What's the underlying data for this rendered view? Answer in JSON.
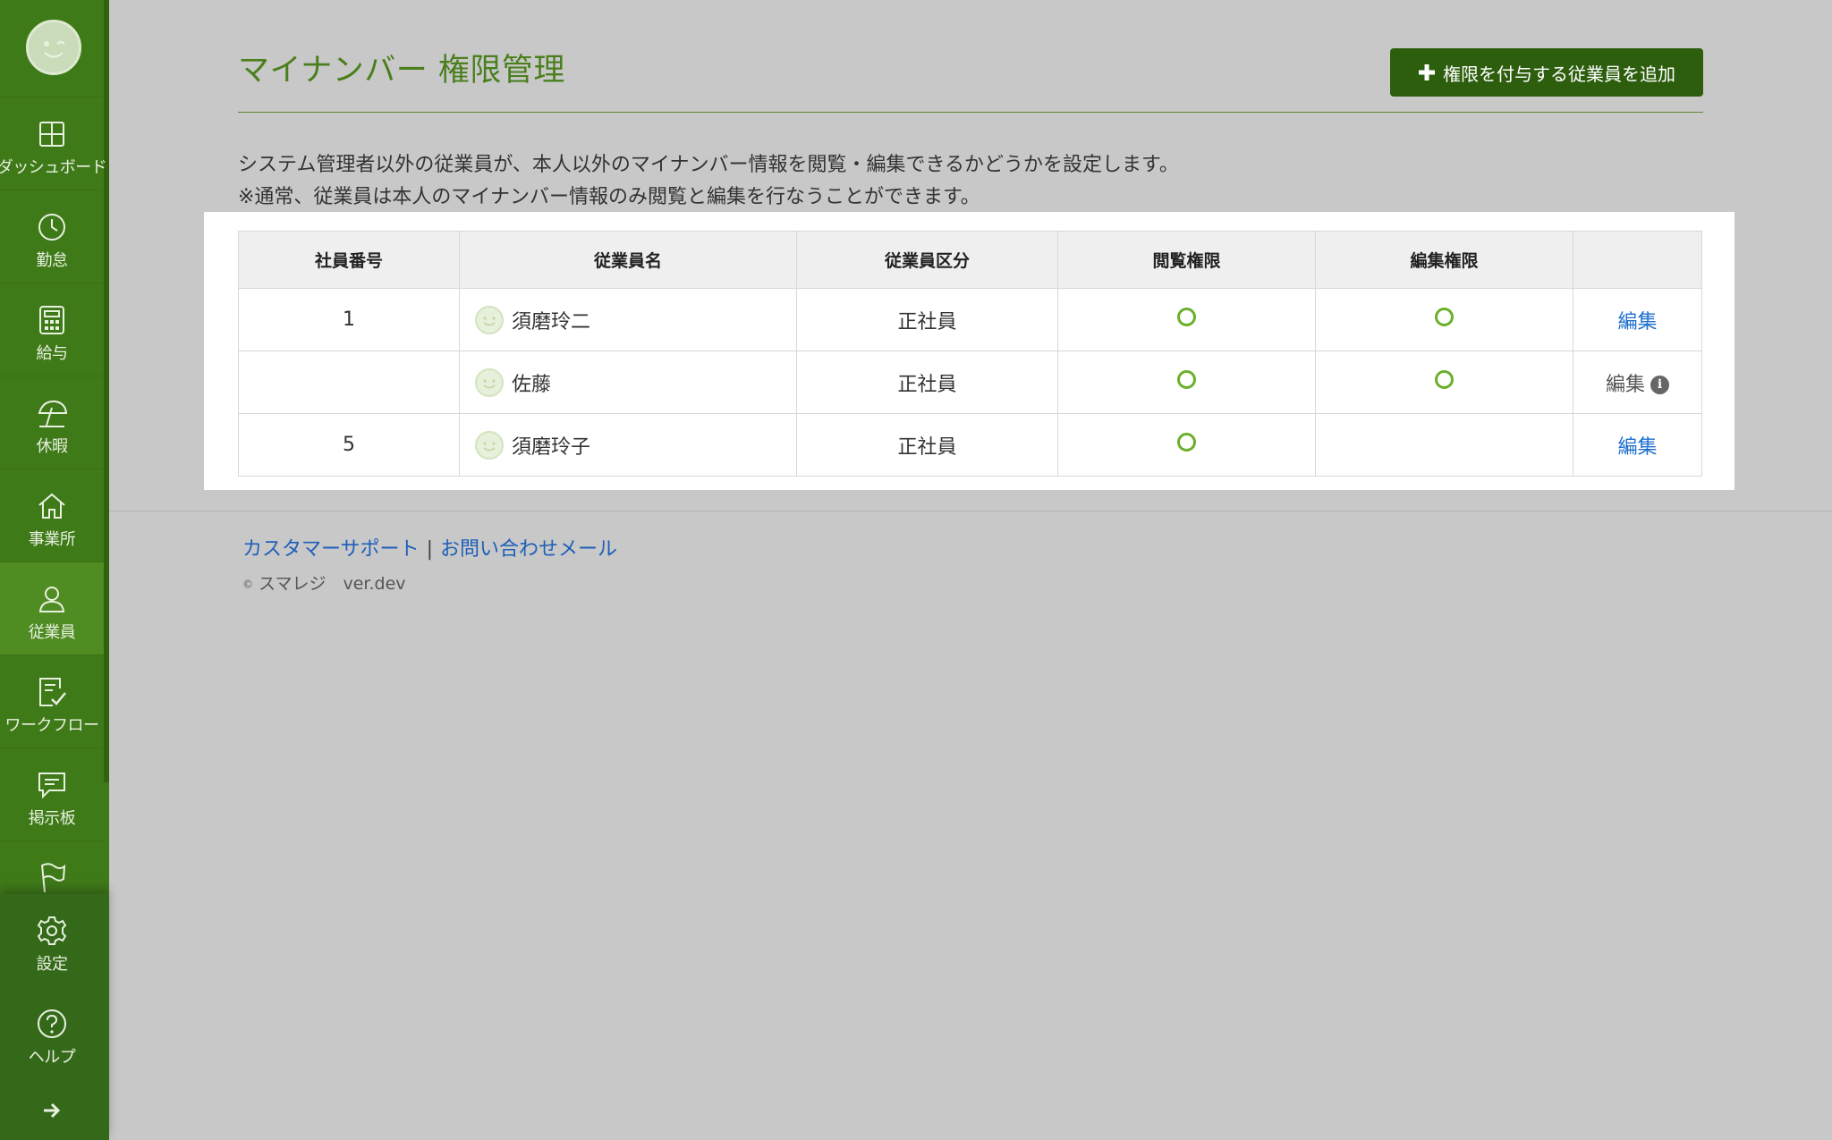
{
  "sidebar": {
    "items": [
      {
        "label": "ダッシュボード",
        "icon": "dashboard-icon"
      },
      {
        "label": "勤怠",
        "icon": "clock-icon"
      },
      {
        "label": "給与",
        "icon": "calculator-icon"
      },
      {
        "label": "休暇",
        "icon": "umbrella-icon"
      },
      {
        "label": "事業所",
        "icon": "home-icon"
      },
      {
        "label": "従業員",
        "icon": "person-icon",
        "active": true
      },
      {
        "label": "ワークフロー",
        "icon": "checklist-icon"
      },
      {
        "label": "掲示板",
        "icon": "chat-icon"
      }
    ],
    "bottom_items": [
      {
        "label": "設定",
        "icon": "gear-icon"
      },
      {
        "label": "ヘルプ",
        "icon": "help-icon"
      }
    ]
  },
  "header": {
    "title": "マイナンバー 権限管理",
    "add_button_label": "権限を付与する従業員を追加"
  },
  "description": {
    "line1": "システム管理者以外の従業員が、本人以外のマイナンバー情報を閲覧・編集できるかどうかを設定します。",
    "line2": "※通常、従業員は本人のマイナンバー情報のみ閲覧と編集を行なうことができます。"
  },
  "table": {
    "columns": [
      "社員番号",
      "従業員名",
      "従業員区分",
      "閲覧権限",
      "編集権限",
      ""
    ],
    "rows": [
      {
        "employee_no": "1",
        "name": "須磨玲二",
        "type": "正社員",
        "view": true,
        "edit": true,
        "action": "編集",
        "action_enabled": true
      },
      {
        "employee_no": "",
        "name": "佐藤",
        "type": "正社員",
        "view": true,
        "edit": true,
        "action": "編集",
        "action_enabled": false
      },
      {
        "employee_no": "5",
        "name": "須磨玲子",
        "type": "正社員",
        "view": true,
        "edit": false,
        "action": "編集",
        "action_enabled": true
      }
    ]
  },
  "footer": {
    "support_link": "カスタマーサポート",
    "separator": "|",
    "contact_link": "お問い合わせメール",
    "copyright_symbol": "©",
    "copyright": "スマレジ　ver.dev"
  },
  "colors": {
    "sidebar": "#3f7a19",
    "title": "#4a7f1d",
    "button": "#2d5e0e",
    "check": "#6ab02a",
    "link": "#1e6fcf"
  }
}
